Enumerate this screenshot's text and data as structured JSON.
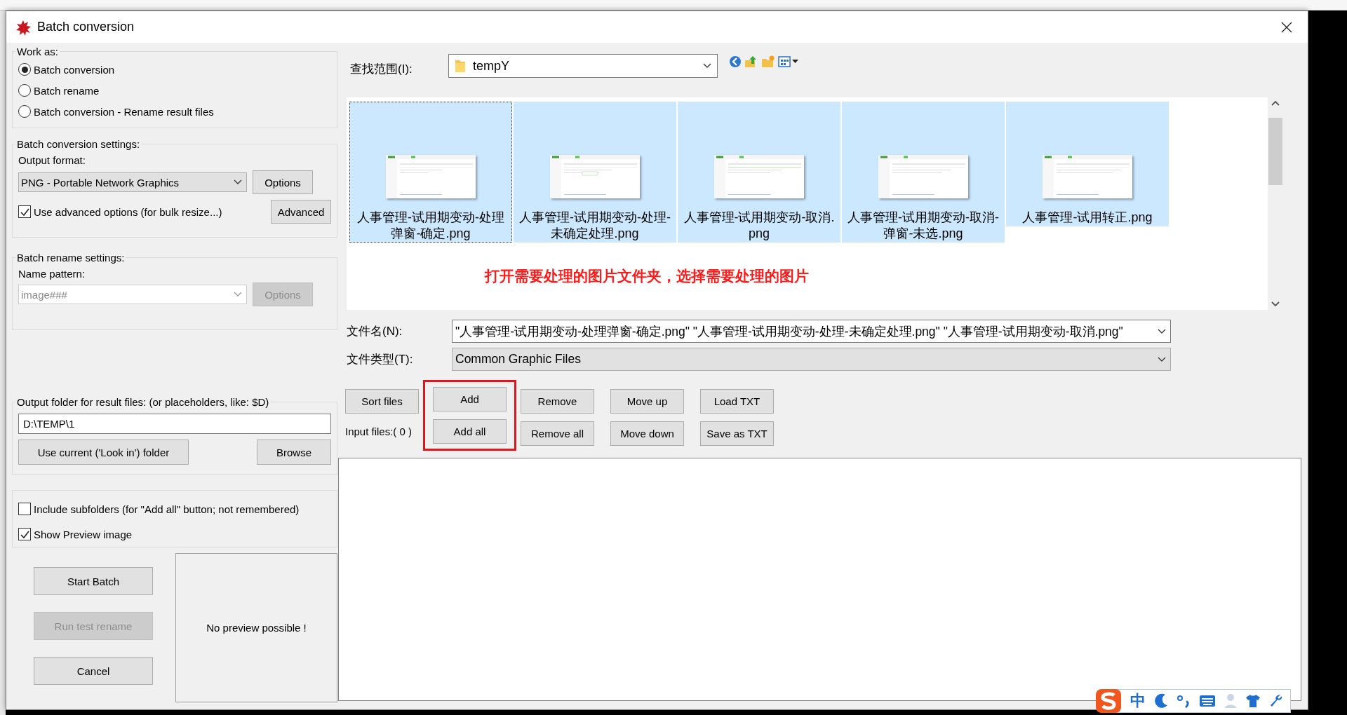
{
  "window": {
    "title": "Batch conversion"
  },
  "work_as": {
    "label": "Work as:",
    "options": [
      {
        "label": "Batch conversion",
        "selected": true
      },
      {
        "label": "Batch rename",
        "selected": false
      },
      {
        "label": "Batch conversion - Rename result files",
        "selected": false
      }
    ]
  },
  "conversion_settings": {
    "label": "Batch conversion settings:",
    "format_label": "Output format:",
    "format": "PNG - Portable Network Graphics",
    "options_button": "Options",
    "advanced_option": {
      "label": "Use advanced options (for bulk resize...)",
      "checked": true
    },
    "advanced_button": "Advanced"
  },
  "rename_settings": {
    "label": "Batch rename settings:",
    "pattern_label": "Name pattern:",
    "pattern": "image###",
    "disabled": true,
    "options_button": "Options"
  },
  "output_folder": {
    "label": "Output folder for result files: (or placeholders, like: $D)",
    "value": "D:\\TEMP\\1",
    "use_current_button": "Use current ('Look in') folder",
    "browse_button": "Browse"
  },
  "options": [
    {
      "label": "Include subfolders (for \"Add all\" button; not remembered)",
      "checked": false
    },
    {
      "label": "Show Preview image",
      "checked": true
    }
  ],
  "actions": [
    {
      "label": "Start Batch",
      "disabled": false
    },
    {
      "label": "Run test rename",
      "disabled": true
    },
    {
      "label": "Cancel",
      "disabled": false
    }
  ],
  "preview": {
    "text": "No preview possible !"
  },
  "look_in": {
    "label": "查找范围(I):",
    "folder": "tempY"
  },
  "files": [
    {
      "name": "人事管理-试用期变动-处理弹窗-确定.png",
      "selected": true,
      "focused": true
    },
    {
      "name": "人事管理-试用期变动-处理-未确定处理.png",
      "selected": true,
      "focused": false
    },
    {
      "name": "人事管理-试用期变动-取消.png",
      "selected": true,
      "focused": false
    },
    {
      "name": "人事管理-试用期变动-取消-弹窗-未选.png",
      "selected": true,
      "focused": false
    },
    {
      "name": "人事管理-试用转正.png",
      "selected": true,
      "focused": false
    }
  ],
  "annotation": "打开需要处理的图片文件夹，选择需要处理的图片",
  "file_name": {
    "label": "文件名(N):",
    "value": "\"人事管理-试用期变动-处理弹窗-确定.png\" \"人事管理-试用期变动-处理-未确定处理.png\" \"人事管理-试用期变动-取消.png\""
  },
  "file_type": {
    "label": "文件类型(T):",
    "value": "Common Graphic Files"
  },
  "list_button_columns": [
    {
      "buttons": [
        "Sort files"
      ],
      "highlighted": false
    },
    {
      "buttons": [
        "Add",
        "Add all"
      ],
      "highlighted": true
    },
    {
      "buttons": [
        "Remove",
        "Remove all"
      ],
      "highlighted": false
    },
    {
      "buttons": [
        "Move up",
        "Move down"
      ],
      "highlighted": false
    },
    {
      "buttons": [
        "Load TXT",
        "Save as TXT"
      ],
      "highlighted": false
    }
  ],
  "input_files_label": "Input files:( 0 )",
  "ime_bar": {
    "mode": "中"
  }
}
